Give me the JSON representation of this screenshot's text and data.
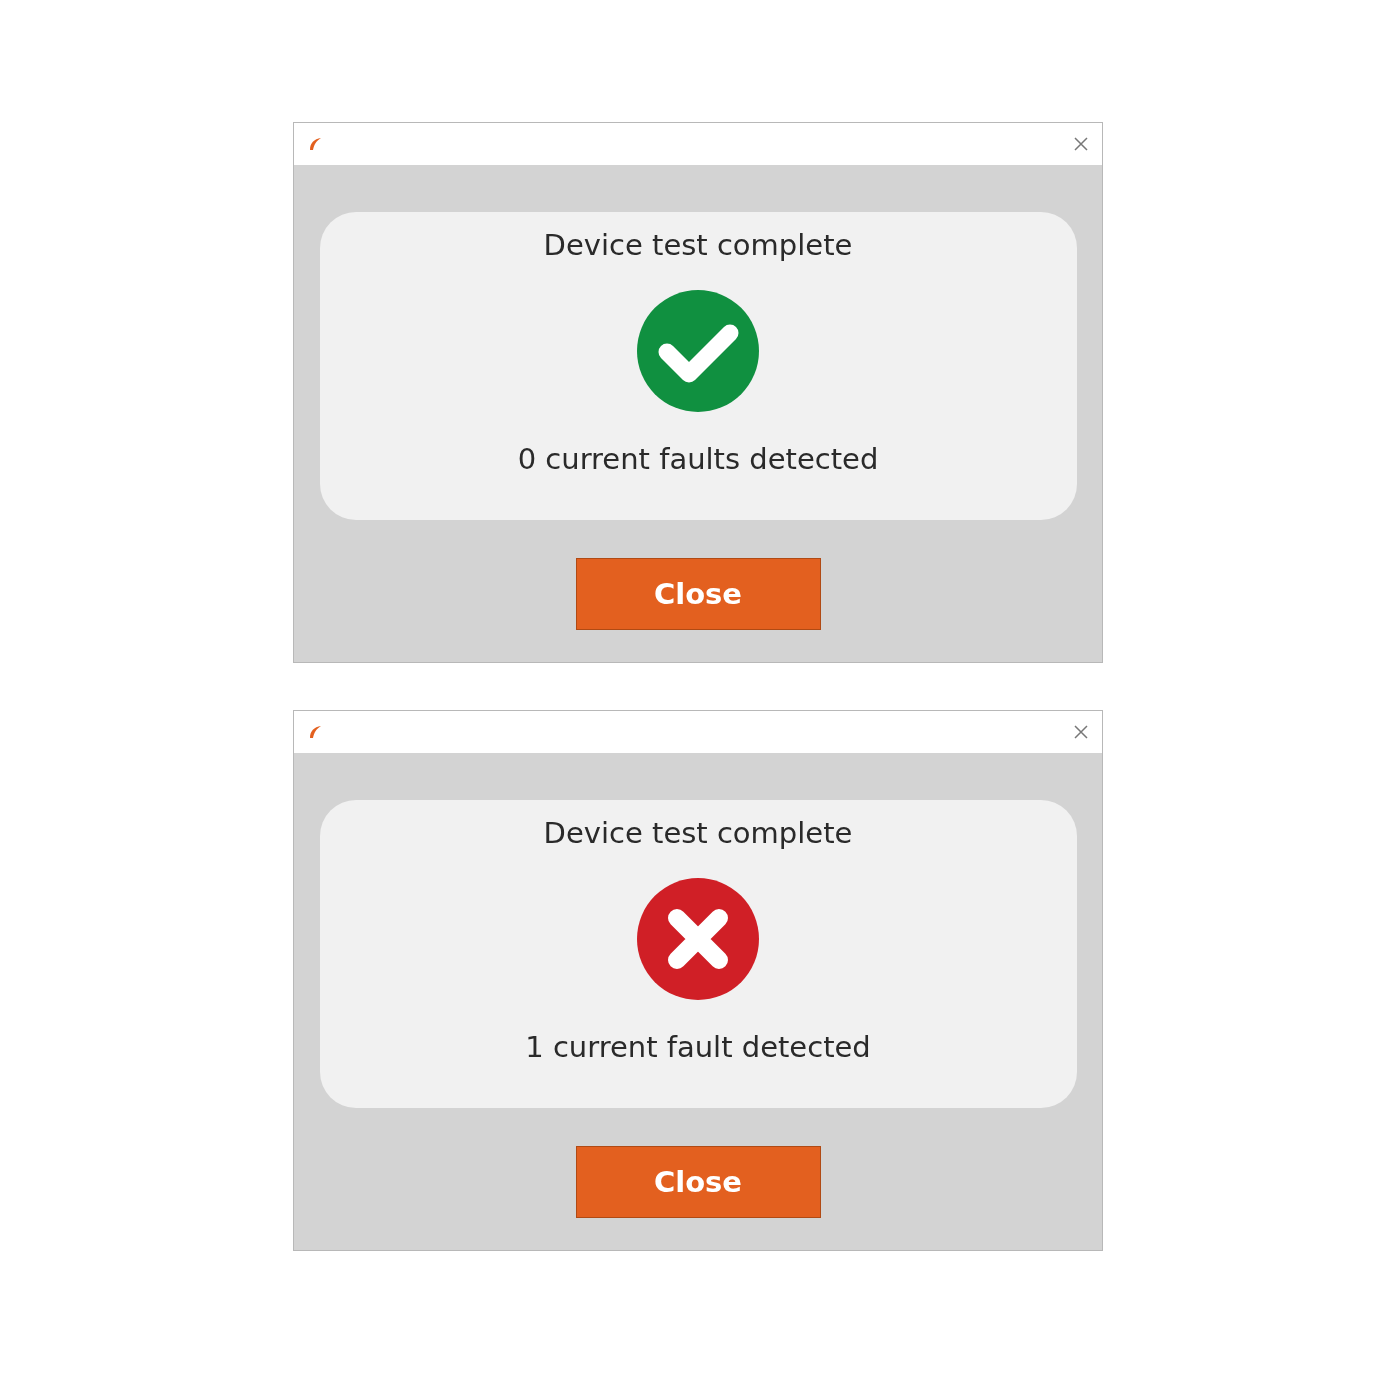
{
  "dialogs": [
    {
      "heading": "Device test complete",
      "kind": "success",
      "message": "0 current faults detected",
      "button": "Close"
    },
    {
      "heading": "Device test complete",
      "kind": "error",
      "message": "1 current fault detected",
      "button": "Close"
    }
  ]
}
